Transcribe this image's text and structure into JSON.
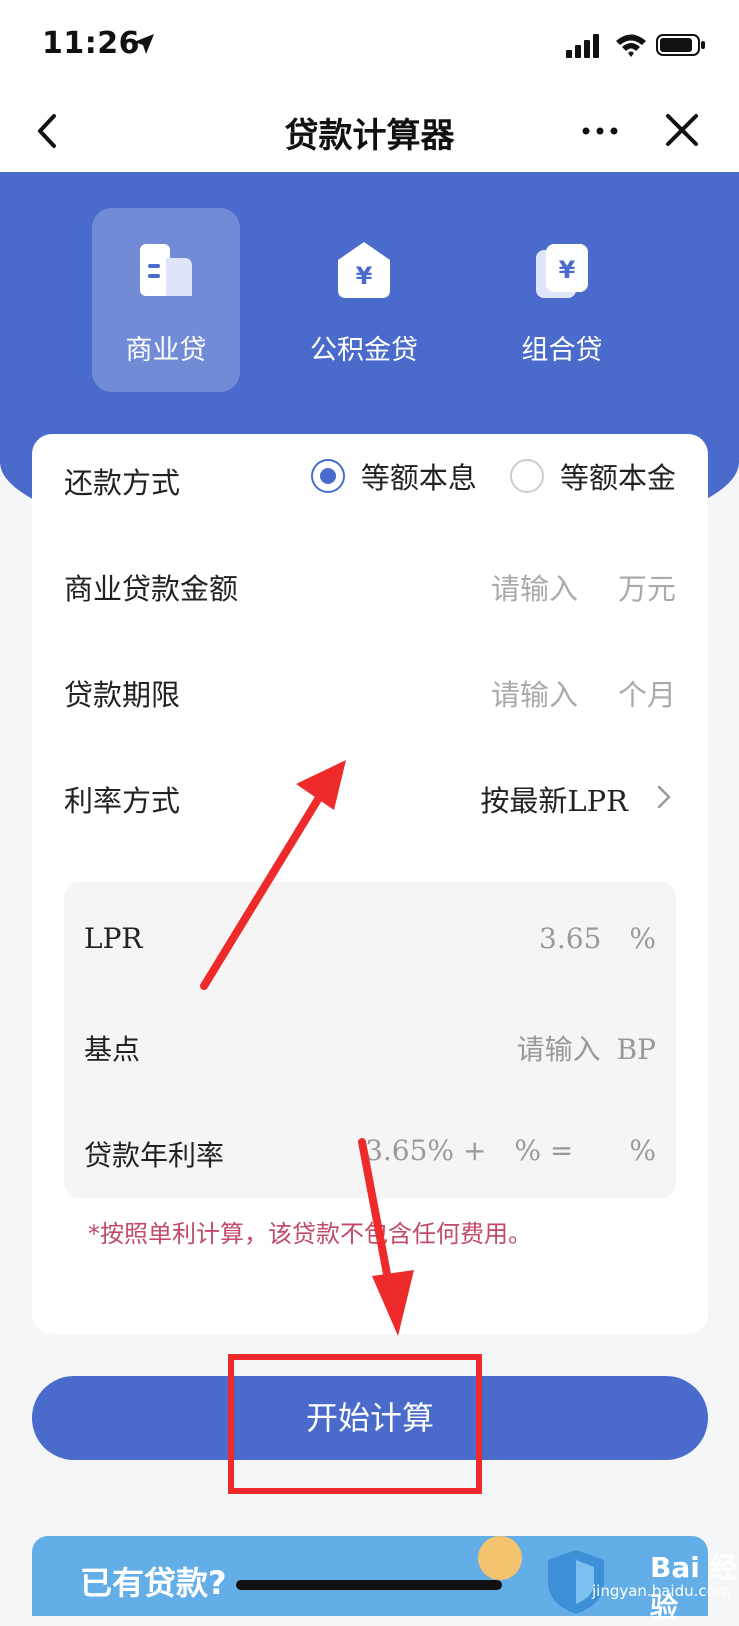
{
  "status_bar": {
    "time": "11:26"
  },
  "nav": {
    "title": "贷款计算器"
  },
  "tabs": [
    {
      "label": "商业贷",
      "active": true,
      "icon": "building-icon"
    },
    {
      "label": "公积金贷",
      "active": false,
      "icon": "house-yen-icon"
    },
    {
      "label": "组合贷",
      "active": false,
      "icon": "cards-yen-icon"
    }
  ],
  "form": {
    "repayment": {
      "label": "还款方式",
      "options": [
        "等额本息",
        "等额本金"
      ],
      "selected": "等额本息"
    },
    "amount": {
      "label": "商业贷款金额",
      "placeholder": "请输入",
      "unit": "万元"
    },
    "term": {
      "label": "贷款期限",
      "placeholder": "请输入",
      "unit": "个月"
    },
    "rate_mode": {
      "label": "利率方式",
      "value": "按最新LPR"
    },
    "lpr": {
      "label": "LPR",
      "value": "3.65",
      "unit": "%"
    },
    "basis_points": {
      "label": "基点",
      "placeholder": "请输入",
      "unit": "BP"
    },
    "annual_rate": {
      "label": "贷款年利率",
      "base": "3.65%",
      "plus": "+",
      "mid_unit": "%",
      "eq": "=",
      "end_unit": "%"
    },
    "note": "*按照单利计算，该贷款不包含任何费用。"
  },
  "primary_button": {
    "label": "开始计算"
  },
  "banner": {
    "text": "已有贷款?"
  },
  "watermark": {
    "brand": "Bai 经验",
    "url": "jingyan.baidu.com"
  },
  "colors": {
    "primary": "#4a6bcb",
    "note": "#c14b68",
    "annotation": "#ef2a2a"
  }
}
